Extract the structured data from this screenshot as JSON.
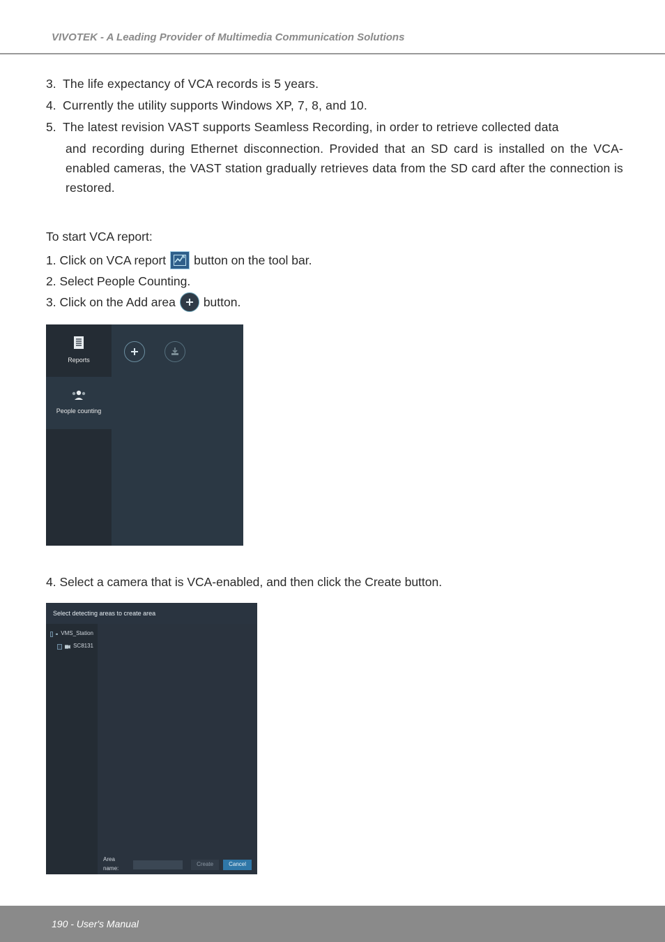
{
  "header": {
    "brand_line": "VIVOTEK - A Leading Provider of Multimedia Communication Solutions"
  },
  "list": {
    "n3": "3.",
    "t3": "The life expectancy of VCA records is 5 years.",
    "n4": "4.",
    "t4": "Currently the utility supports Windows XP, 7, 8, and 10.",
    "n5": "5.",
    "t5a": "The latest revision VAST supports Seamless Recording, in order to retrieve collected data",
    "t5b": "and recording during Ethernet disconnection. Provided that an SD card is installed on the VCA-enabled cameras, the VAST station gradually retrieves data from the SD card after the connection is restored."
  },
  "start": {
    "lead": "To start VCA report:",
    "s1a": "1. Click on VCA report",
    "s1b": " button on the tool bar.",
    "s2": "2. Select People Counting.",
    "s3a": "3. Click on the Add area",
    "s3b": " button."
  },
  "shot1": {
    "tab_reports": "Reports",
    "tab_people": "People counting"
  },
  "step4": "4. Select a camera that is VCA-enabled, and then click the Create button.",
  "shot2": {
    "title": "Select detecting areas to create area",
    "tree_root": "VMS_Station",
    "tree_cam": "SC8131",
    "area_label": "Area name:",
    "btn_create": "Create",
    "btn_cancel": "Cancel"
  },
  "footer": {
    "pageline": "190 - User's Manual"
  }
}
